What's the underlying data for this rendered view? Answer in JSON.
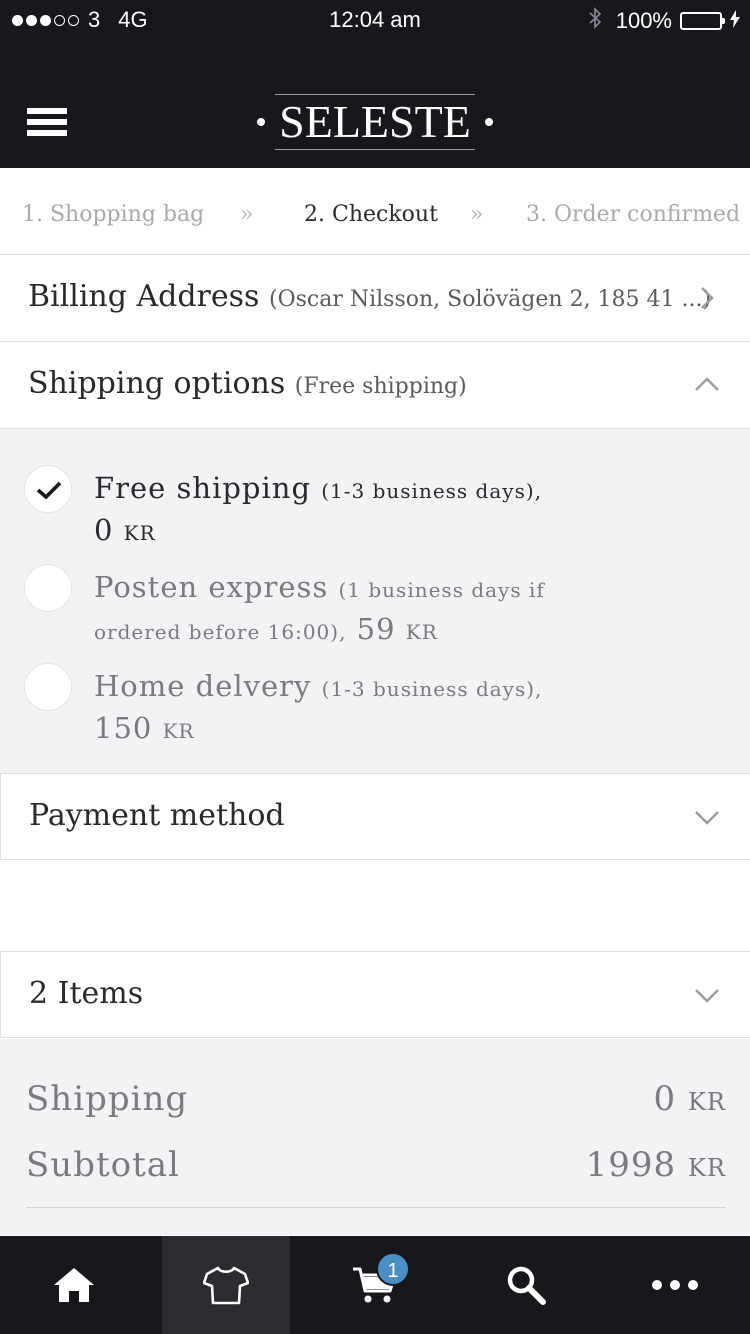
{
  "status_bar": {
    "carrier": "3",
    "network": "4G",
    "time": "12:04 am",
    "battery": "100%"
  },
  "header": {
    "brand": "SELESTE"
  },
  "steps": [
    {
      "label": "1. Shopping bag"
    },
    {
      "label": "2. Checkout"
    },
    {
      "label": "3. Order confirmed"
    }
  ],
  "billing": {
    "title": "Billing Address",
    "summary": "(Oscar Nilsson, Solövägen 2, 185 41 ...)"
  },
  "shipping": {
    "title": "Shipping options",
    "summary": "(Free shipping)",
    "options": [
      {
        "name": "Free shipping",
        "detail": "(1-3 business days),",
        "price": "0",
        "currency": "KR",
        "checked": true
      },
      {
        "name": "Posten express",
        "detail_a": "(1 business days if",
        "detail_b": "ordered before 16:00),",
        "price": "59",
        "currency": "KR",
        "checked": false
      },
      {
        "name": "Home delvery",
        "detail": "(1-3 business days),",
        "price": "150",
        "currency": "KR",
        "checked": false
      }
    ]
  },
  "payment": {
    "title": "Payment method"
  },
  "items": {
    "title": "2 Items"
  },
  "totals": {
    "shipping_label": "Shipping",
    "shipping_value": "0",
    "subtotal_label": "Subtotal",
    "subtotal_value": "1998",
    "currency": "KR"
  },
  "tabbar": {
    "cart_badge": "1",
    "tabs": [
      "home-icon",
      "shirt-icon",
      "cart-icon",
      "search-icon",
      "more-icon"
    ]
  },
  "colors": {
    "dark": "#18181c",
    "panel_bg": "#f3f3f5",
    "badge": "#4a8fc4"
  }
}
